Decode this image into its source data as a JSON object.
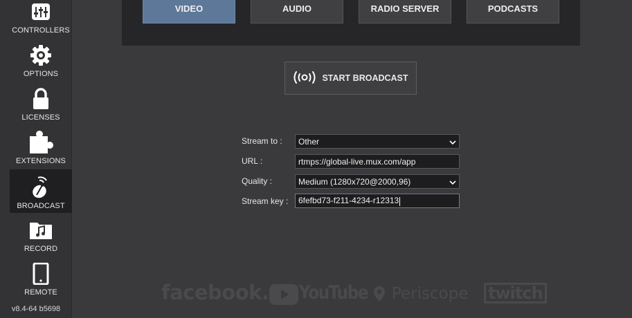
{
  "sidebar": {
    "items": [
      {
        "label": "CONTROLLERS",
        "icon": "sliders-icon"
      },
      {
        "label": "OPTIONS",
        "icon": "gear-icon"
      },
      {
        "label": "LICENSES",
        "icon": "lock-icon"
      },
      {
        "label": "EXTENSIONS",
        "icon": "puzzle-icon"
      },
      {
        "label": "BROADCAST",
        "icon": "broadcast-dish-icon",
        "active": true
      },
      {
        "label": "RECORD",
        "icon": "music-folder-icon"
      },
      {
        "label": "REMOTE",
        "icon": "tablet-icon"
      }
    ],
    "version": "v8.4-64 b5698"
  },
  "tabs": [
    {
      "label": "VIDEO",
      "active": true
    },
    {
      "label": "AUDIO"
    },
    {
      "label": "RADIO SERVER"
    },
    {
      "label": "PODCASTS"
    }
  ],
  "broadcast_button": {
    "label": "START BROADCAST",
    "icon": "broadcast-waves-icon"
  },
  "form": {
    "stream_to": {
      "label": "Stream to :",
      "value": "Other"
    },
    "url": {
      "label": "URL :",
      "value": "rtmps://global-live.mux.com/app"
    },
    "quality": {
      "label": "Quality :",
      "value": "Medium (1280x720@2000,96)"
    },
    "stream_key": {
      "label": "Stream key :",
      "value": "6fefbd73-f211-4234-r12313"
    }
  },
  "logos": {
    "facebook": "facebook.",
    "youtube": "YouTube",
    "periscope": "Periscope",
    "twitch": "twitch"
  },
  "colors": {
    "accent": "#5d7899",
    "background": "#3a3a3c",
    "sidebar": "#333335",
    "logo": "#4a4a4d"
  }
}
